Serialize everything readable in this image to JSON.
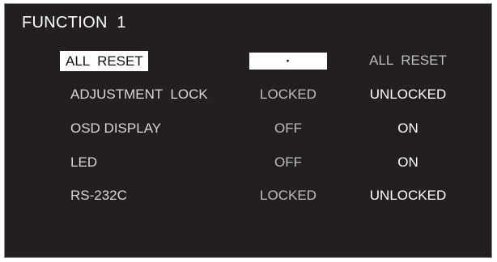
{
  "menu": {
    "title": "FUNCTION  1",
    "rows": [
      {
        "label": "ALL  RESET",
        "option_1": "·",
        "option_2": "ALL  RESET"
      },
      {
        "label": "ADJUSTMENT  LOCK",
        "option_1": "LOCKED",
        "option_2": "UNLOCKED"
      },
      {
        "label": "OSD DISPLAY",
        "option_1": "OFF",
        "option_2": "ON"
      },
      {
        "label": "LED",
        "option_1": "OFF",
        "option_2": "ON"
      },
      {
        "label": "RS-232C",
        "option_1": "LOCKED",
        "option_2": "UNLOCKED"
      }
    ]
  },
  "colors": {
    "background": "#231f20",
    "highlight": "#ffffff",
    "inactive_text": "#bdbdbd",
    "active_text": "#ffffff"
  }
}
